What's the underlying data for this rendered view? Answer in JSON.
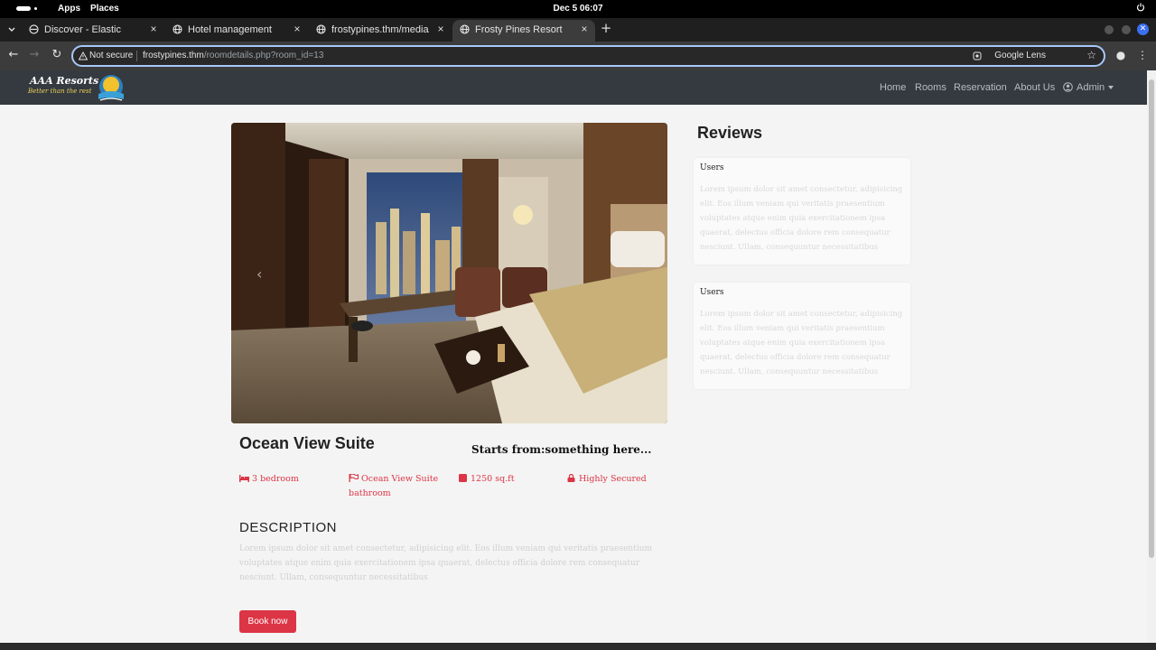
{
  "system": {
    "apps_label": "Apps",
    "places_label": "Places",
    "clock": "Dec 5  06:07"
  },
  "browser": {
    "tabs": [
      {
        "title": "Discover - Elastic",
        "icon": "elastic-icon"
      },
      {
        "title": "Hotel management",
        "icon": "globe-icon"
      },
      {
        "title": "frostypines.thm/media/i",
        "icon": "globe-icon"
      },
      {
        "title": "Frosty Pines Resort",
        "icon": "globe-icon",
        "active": true
      }
    ],
    "omnibox": {
      "security_label": "Not secure",
      "url_host": "frostypines.thm",
      "url_path": "/roomdetails.php?room_id=13",
      "lens_label": "Google Lens"
    }
  },
  "site": {
    "logo_title": "AAA Resorts",
    "logo_tagline": "Better than the rest",
    "nav": {
      "home": "Home",
      "rooms": "Rooms",
      "reservation": "Reservation",
      "about": "About Us",
      "admin": "Admin"
    },
    "room": {
      "title": "Ocean View Suite",
      "price": "Starts from:something here...",
      "features": [
        {
          "icon": "bed-icon",
          "label": "3 bedroom"
        },
        {
          "icon": "flag-icon",
          "label": "Ocean View Suite bathroom"
        },
        {
          "icon": "square-icon",
          "label": "1250 sq.ft"
        },
        {
          "icon": "lock-icon",
          "label": "Highly Secured"
        }
      ],
      "description_heading": "DESCRIPTION",
      "description": "Lorem ipsum dolor sit amet consectetur, adipisicing elit. Eos illum veniam qui veritatis praesentium voluptates atque enim quia exercitationem ipsa quaerat, delectus officia dolore rem consequatur nesciunt. Ullam, consequuntur necessitatibus",
      "book_label": "Book now"
    },
    "reviews": {
      "heading": "Reviews",
      "items": [
        {
          "user": "Users",
          "text": "Lorem ipsum dolor sit amet consectetur, adipisicing elit. Eos illum veniam qui veritatis praesentium voluptates atque enim quia exercitationem ipsa quaerat, delectus officia dolore rem consequatur nesciunt. Ullam, consequuntur necessitatibus"
        },
        {
          "user": "Users",
          "text": "Lorem ipsum dolor sit amet consectetur, adipisicing elit. Eos illum veniam qui veritatis praesentium voluptates atque enim quia exercitationem ipsa quaerat, delectus officia dolore rem consequatur nesciunt. Ullam, consequuntur necessitatibus"
        }
      ]
    }
  },
  "colors": {
    "accent": "#dc3545",
    "navbar": "#343a40",
    "browser_frame": "#3c3c3c",
    "omnibox_focus": "#a8c7fa"
  }
}
